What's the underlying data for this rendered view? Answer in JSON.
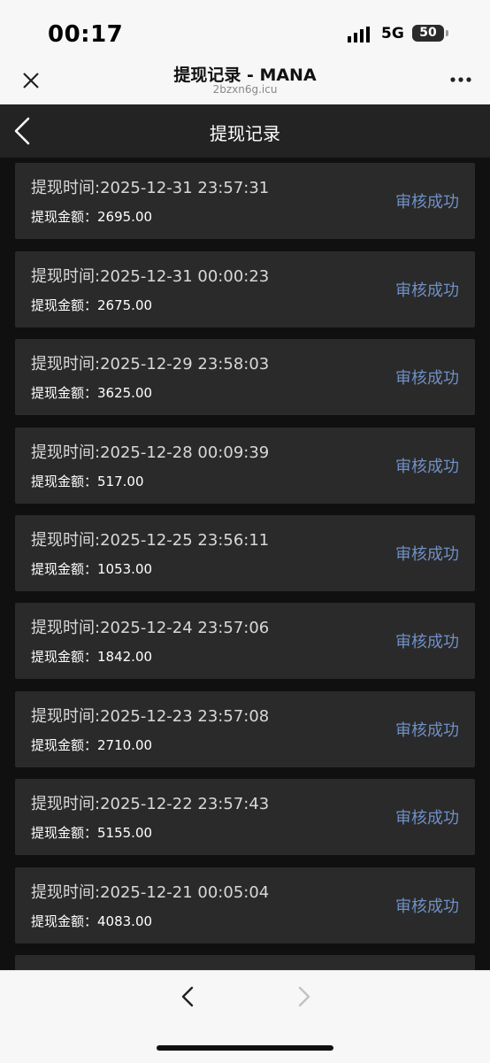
{
  "status_bar": {
    "time": "00:17",
    "network": "5G",
    "battery": "50"
  },
  "browser": {
    "title": "提现记录 - MANA",
    "url": "2bzxn6g.icu"
  },
  "header": {
    "title": "提现记录"
  },
  "labels": {
    "time_prefix": "提现时间:",
    "amount_prefix": "提现金额："
  },
  "records": [
    {
      "time": "提现时间:2025-12-31 23:57:31",
      "amount": "提现金额：2695.00",
      "status": "审核成功"
    },
    {
      "time": "提现时间:2025-12-31 00:00:23",
      "amount": "提现金额：2675.00",
      "status": "审核成功"
    },
    {
      "time": "提现时间:2025-12-29 23:58:03",
      "amount": "提现金额：3625.00",
      "status": "审核成功"
    },
    {
      "time": "提现时间:2025-12-28 00:09:39",
      "amount": "提现金额：517.00",
      "status": "审核成功"
    },
    {
      "time": "提现时间:2025-12-25 23:56:11",
      "amount": "提现金额：1053.00",
      "status": "审核成功"
    },
    {
      "time": "提现时间:2025-12-24 23:57:06",
      "amount": "提现金额：1842.00",
      "status": "审核成功"
    },
    {
      "time": "提现时间:2025-12-23 23:57:08",
      "amount": "提现金额：2710.00",
      "status": "审核成功"
    },
    {
      "time": "提现时间:2025-12-22 23:57:43",
      "amount": "提现金额：5155.00",
      "status": "审核成功"
    },
    {
      "time": "提现时间:2025-12-21 00:05:04",
      "amount": "提现金额：4083.00",
      "status": "审核成功"
    }
  ],
  "colors": {
    "status_text": "#6f90c6",
    "card_bg": "#2a2a2a",
    "page_bg": "#101010"
  }
}
